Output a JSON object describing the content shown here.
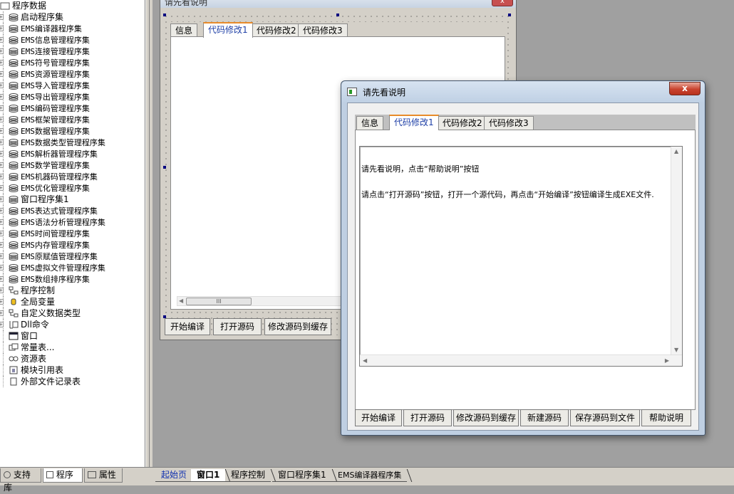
{
  "tree": {
    "items": [
      {
        "label": "程序数据",
        "icon": "folder-icon",
        "root": true
      },
      {
        "label": "启动程序集",
        "icon": "assembly-icon"
      },
      {
        "label": "EMS编译器程序集",
        "icon": "assembly-icon"
      },
      {
        "label": "EMS信息管理程序集",
        "icon": "assembly-icon"
      },
      {
        "label": "EMS连接管理程序集",
        "icon": "assembly-icon"
      },
      {
        "label": "EMS符号管理程序集",
        "icon": "assembly-icon"
      },
      {
        "label": "EMS资源管理程序集",
        "icon": "assembly-icon"
      },
      {
        "label": "EMS导入管理程序集",
        "icon": "assembly-icon"
      },
      {
        "label": "EMS导出管理程序集",
        "icon": "assembly-icon"
      },
      {
        "label": "EMS编码管理程序集",
        "icon": "assembly-icon"
      },
      {
        "label": "EMS框架管理程序集",
        "icon": "assembly-icon"
      },
      {
        "label": "EMS数据管理程序集",
        "icon": "assembly-icon"
      },
      {
        "label": "EMS数据类型管理程序集",
        "icon": "assembly-icon"
      },
      {
        "label": "EMS解析器管理程序集",
        "icon": "assembly-icon"
      },
      {
        "label": "EMS数学管理程序集",
        "icon": "assembly-icon"
      },
      {
        "label": "EMS机器码管理程序集",
        "icon": "assembly-icon"
      },
      {
        "label": "EMS优化管理程序集",
        "icon": "assembly-icon"
      },
      {
        "label": "窗口程序集1",
        "icon": "assembly-icon"
      },
      {
        "label": "EMS表达式管理程序集",
        "icon": "assembly-icon"
      },
      {
        "label": "EMS语法分析管理程序集",
        "icon": "assembly-icon"
      },
      {
        "label": "EMS时间管理程序集",
        "icon": "assembly-icon"
      },
      {
        "label": "EMS内存管理程序集",
        "icon": "assembly-icon"
      },
      {
        "label": "EMS原赋值管理程序集",
        "icon": "assembly-icon"
      },
      {
        "label": "EMS虚拟文件管理程序集",
        "icon": "assembly-icon"
      },
      {
        "label": "EMS数组排序程序集",
        "icon": "assembly-icon"
      },
      {
        "label": "程序控制",
        "icon": "flow-icon"
      },
      {
        "label": "全局变量",
        "icon": "cylinder-icon"
      },
      {
        "label": "自定义数据类型",
        "icon": "flow-icon"
      },
      {
        "label": "Dll命令",
        "icon": "dll-icon"
      },
      {
        "label": "窗口",
        "icon": "window-icon"
      },
      {
        "label": "常量表...",
        "icon": "constant-icon"
      },
      {
        "label": "资源表",
        "icon": "resource-icon"
      },
      {
        "label": "模块引用表",
        "icon": "module-icon"
      },
      {
        "label": "外部文件记录表",
        "icon": "file-icon"
      }
    ]
  },
  "left_tabs": [
    {
      "label": "支持库",
      "icon": "library-icon"
    },
    {
      "label": "程序",
      "icon": "program-icon",
      "active": true
    },
    {
      "label": "属性",
      "icon": "property-icon"
    }
  ],
  "doc_tabs": [
    {
      "label": "起始页"
    },
    {
      "label": "窗口1",
      "active": true
    },
    {
      "label": "程序控制"
    },
    {
      "label": "窗口程序集1"
    },
    {
      "label": "EMS编译器程序集"
    }
  ],
  "design_form": {
    "title": "请先看说明",
    "close": "x",
    "tabs": [
      "信息",
      "代码修改1",
      "代码修改2",
      "代码修改3"
    ],
    "scroll_grip": "III",
    "buttons": [
      "开始编译",
      "打开源码",
      "修改源码到缓存"
    ]
  },
  "dialog": {
    "title": "请先看说明",
    "close": "x",
    "tabs": [
      "信息",
      "代码修改1",
      "代码修改2",
      "代码修改3"
    ],
    "text_line1": "请先看说明，点击“帮助说明”按钮",
    "text_line2": "请点击“打开源码”按钮，打开一个源代码，再点击“开始编译”按钮编译生成EXE文件.",
    "buttons": [
      "开始编译",
      "打开源码",
      "修改源码到缓存",
      "新建源码",
      "保存源码到文件",
      "帮助说明"
    ]
  },
  "colors": {
    "active_tab_text": "#1e3fa6",
    "active_tab_accent": "#e88b2a",
    "close_button": "#c9432e"
  }
}
